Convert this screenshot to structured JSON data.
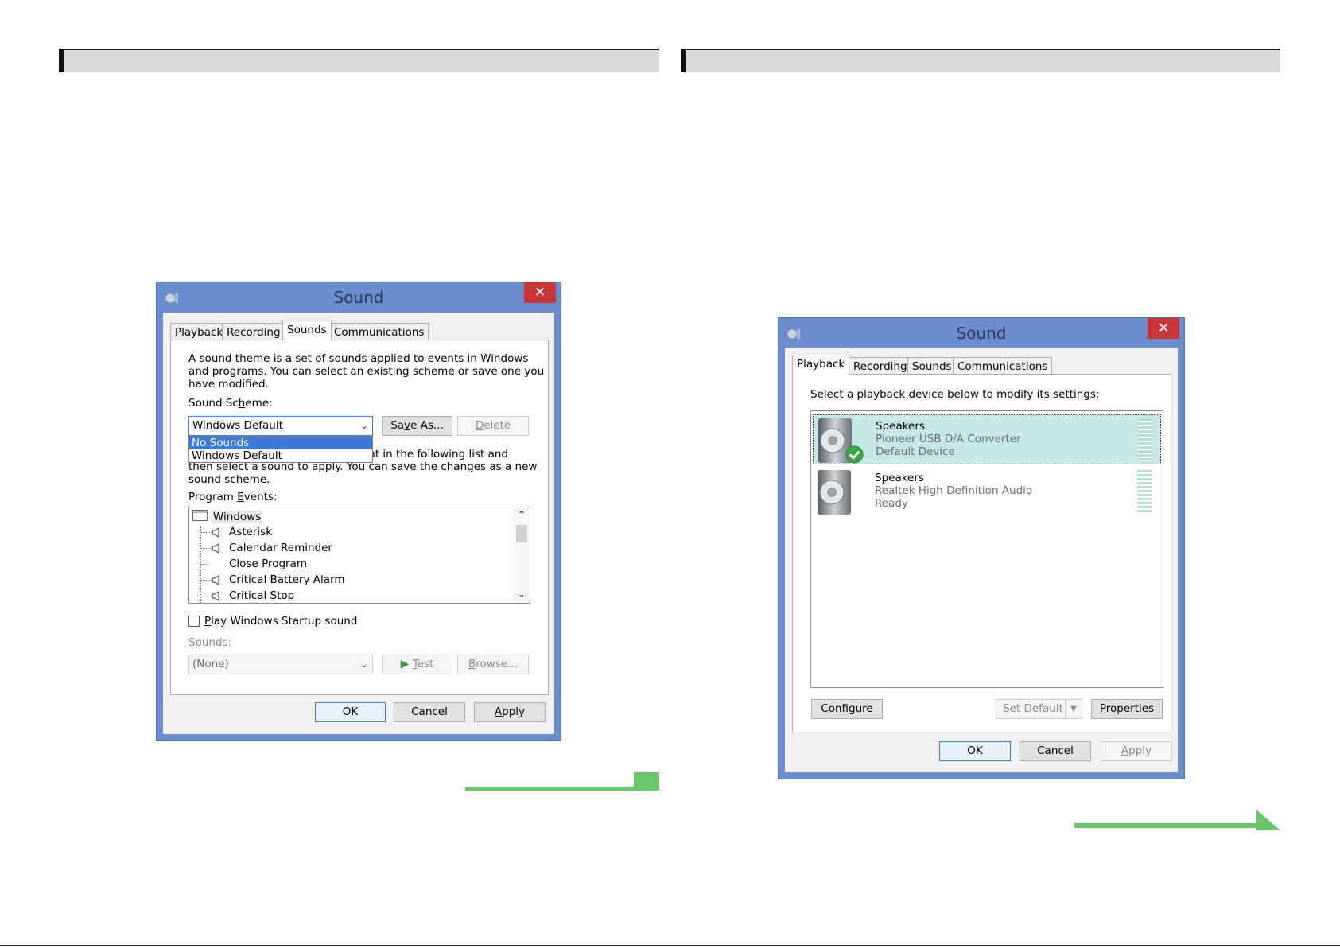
{
  "dialog_left": {
    "title": "Sound",
    "tabs": [
      "Playback",
      "Recording",
      "Sounds",
      "Communications"
    ],
    "active_tab": "Sounds",
    "description": [
      "A sound theme is a set of sounds applied to events in Windows",
      "and programs.  You can select an existing scheme or save one you",
      "have modified."
    ],
    "scheme_label_pre": "Sound Sc",
    "scheme_label_u": "h",
    "scheme_label_post": "eme:",
    "scheme_value": "Windows Default",
    "scheme_options": [
      "No Sounds",
      "Windows Default"
    ],
    "save_as_pre": "Sa",
    "save_as_u": "v",
    "save_as_post": "e As...",
    "delete_u": "D",
    "delete_post": "elete",
    "hidden_text": [
      "vent in the following list and",
      "then select a sound to apply.  You can save the changes as a new",
      "sound scheme."
    ],
    "events_label_pre": "Program ",
    "events_label_u": "E",
    "events_label_post": "vents:",
    "events_root": "Windows",
    "events": [
      "Asterisk",
      "Calendar Reminder",
      "Close Program",
      "Critical Battery Alarm",
      "Critical Stop"
    ],
    "startup_pre": "",
    "startup_u": "P",
    "startup_post": "lay Windows Startup sound",
    "sounds_label_u": "S",
    "sounds_label_post": "ounds:",
    "sounds_value": "(None)",
    "test_u": "T",
    "test_post": "est",
    "browse_u": "B",
    "browse_post": "rowse...",
    "ok": "OK",
    "cancel": "Cancel",
    "apply_u": "A",
    "apply_post": "pply"
  },
  "dialog_right": {
    "title": "Sound",
    "tabs": [
      "Playback",
      "Recording",
      "Sounds",
      "Communications"
    ],
    "active_tab": "Playback",
    "instruction": "Select a playback device below to modify its settings:",
    "devices": [
      {
        "name": "Speakers",
        "detail": "Pioneer USB D/A Converter",
        "status": "Default Device"
      },
      {
        "name": "Speakers",
        "detail": "Realtek High Definition Audio",
        "status": "Ready"
      }
    ],
    "configure_u": "C",
    "configure_post": "onfigure",
    "set_default_u": "S",
    "set_default_post": "et Default",
    "properties_u": "P",
    "properties_post": "roperties",
    "ok": "OK",
    "cancel": "Cancel",
    "apply_u": "A",
    "apply_post": "pply"
  },
  "colors": {
    "title_bar": "#6b8dcc",
    "close_button": "#c7373a",
    "selection": "#3c7bd6",
    "device_highlight": "#c7e6ea",
    "accent_green": "#6cc56b"
  }
}
